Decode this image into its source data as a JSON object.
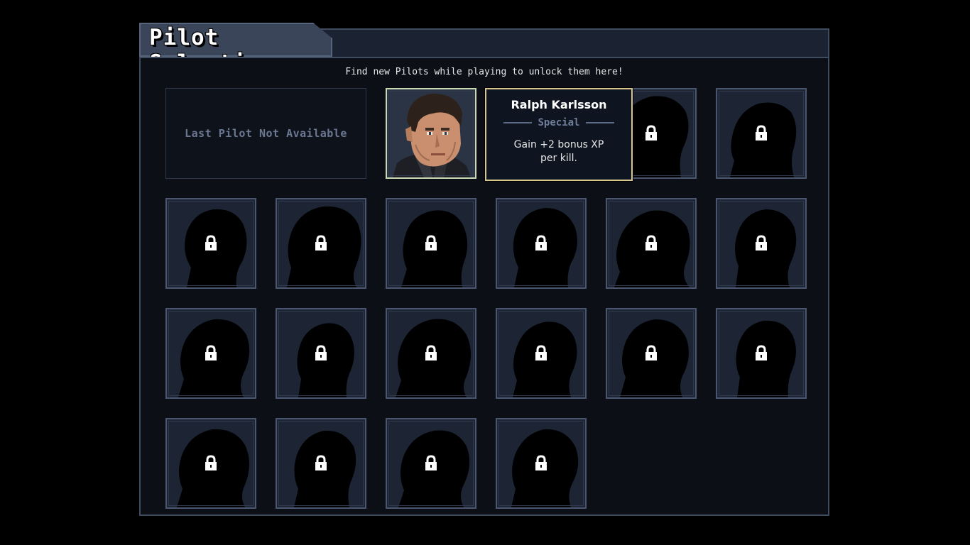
{
  "window": {
    "title": "Pilot Selection"
  },
  "instruction": "Find new Pilots while playing to unlock them here!",
  "last_pilot": {
    "label": "Last Pilot Not Available"
  },
  "tooltip": {
    "name": "Ralph Karlsson",
    "category": "Special",
    "description": "Gain +2 bonus XP per kill."
  },
  "icons": {
    "lock": "lock-icon"
  },
  "colors": {
    "tooltip_border": "#d7c58e",
    "selected_border": "#c9d9b3",
    "slot_border": "#4a5670"
  },
  "pilots": [
    {
      "row": 1,
      "col": 3,
      "state": "unlocked",
      "name": "Ralph Karlsson"
    },
    {
      "row": 1,
      "col": 4,
      "state": "locked"
    },
    {
      "row": 1,
      "col": 5,
      "state": "locked"
    },
    {
      "row": 1,
      "col": 6,
      "state": "locked"
    },
    {
      "row": 2,
      "col": 1,
      "state": "locked"
    },
    {
      "row": 2,
      "col": 2,
      "state": "locked"
    },
    {
      "row": 2,
      "col": 3,
      "state": "locked"
    },
    {
      "row": 2,
      "col": 4,
      "state": "locked"
    },
    {
      "row": 2,
      "col": 5,
      "state": "locked"
    },
    {
      "row": 2,
      "col": 6,
      "state": "locked"
    },
    {
      "row": 3,
      "col": 1,
      "state": "locked"
    },
    {
      "row": 3,
      "col": 2,
      "state": "locked"
    },
    {
      "row": 3,
      "col": 3,
      "state": "locked"
    },
    {
      "row": 3,
      "col": 4,
      "state": "locked"
    },
    {
      "row": 3,
      "col": 5,
      "state": "locked"
    },
    {
      "row": 3,
      "col": 6,
      "state": "locked"
    },
    {
      "row": 4,
      "col": 1,
      "state": "locked"
    },
    {
      "row": 4,
      "col": 2,
      "state": "locked"
    },
    {
      "row": 4,
      "col": 3,
      "state": "locked"
    },
    {
      "row": 4,
      "col": 4,
      "state": "locked"
    }
  ]
}
